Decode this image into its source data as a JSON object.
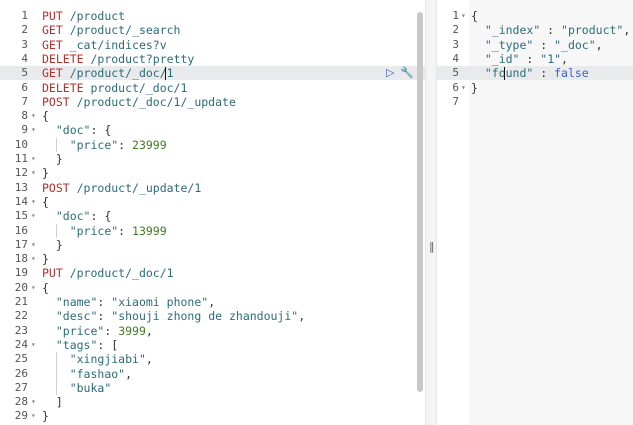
{
  "request_editor": {
    "lines": [
      {
        "n": "1",
        "fold": false,
        "tokens": [
          [
            "method",
            "PUT"
          ],
          [
            "path",
            " /product"
          ]
        ]
      },
      {
        "n": "2",
        "fold": false,
        "tokens": [
          [
            "method",
            "GET"
          ],
          [
            "path",
            " /product/_search"
          ]
        ]
      },
      {
        "n": "3",
        "fold": false,
        "tokens": [
          [
            "method",
            "GET"
          ],
          [
            "path",
            " _cat/indices?v"
          ]
        ]
      },
      {
        "n": "4",
        "fold": false,
        "tokens": [
          [
            "method",
            "DELETE"
          ],
          [
            "path",
            " /product?pretty"
          ]
        ]
      },
      {
        "n": "5",
        "fold": false,
        "tokens": [
          [
            "method",
            "GET"
          ],
          [
            "path",
            " /product/_doc/1"
          ]
        ]
      },
      {
        "n": "6",
        "fold": false,
        "tokens": [
          [
            "method",
            "DELETE"
          ],
          [
            "path",
            " product/_doc/1"
          ]
        ]
      },
      {
        "n": "7",
        "fold": false,
        "tokens": [
          [
            "method",
            "POST"
          ],
          [
            "path",
            " /product/_doc/1/_update"
          ]
        ]
      },
      {
        "n": "8",
        "fold": true,
        "tokens": [
          [
            "brace",
            "{"
          ]
        ]
      },
      {
        "n": "9",
        "fold": true,
        "tokens": [
          [
            "brace",
            "  "
          ],
          [
            "key",
            "\"doc\""
          ],
          [
            "brace",
            ": {"
          ]
        ]
      },
      {
        "n": "10",
        "fold": false,
        "tokens": [
          [
            "brace",
            "    "
          ],
          [
            "key",
            "\"price\""
          ],
          [
            "brace",
            ": "
          ],
          [
            "num",
            "23999"
          ]
        ]
      },
      {
        "n": "11",
        "fold": true,
        "tokens": [
          [
            "brace",
            "  }"
          ]
        ]
      },
      {
        "n": "12",
        "fold": true,
        "tokens": [
          [
            "brace",
            "}"
          ]
        ]
      },
      {
        "n": "13",
        "fold": false,
        "tokens": [
          [
            "method",
            "POST"
          ],
          [
            "path",
            " /product/_update/1"
          ]
        ]
      },
      {
        "n": "14",
        "fold": true,
        "tokens": [
          [
            "brace",
            "{"
          ]
        ]
      },
      {
        "n": "15",
        "fold": true,
        "tokens": [
          [
            "brace",
            "  "
          ],
          [
            "key",
            "\"doc\""
          ],
          [
            "brace",
            ": {"
          ]
        ]
      },
      {
        "n": "16",
        "fold": false,
        "tokens": [
          [
            "brace",
            "    "
          ],
          [
            "key",
            "\"price\""
          ],
          [
            "brace",
            ": "
          ],
          [
            "num",
            "13999"
          ]
        ]
      },
      {
        "n": "17",
        "fold": true,
        "tokens": [
          [
            "brace",
            "  }"
          ]
        ]
      },
      {
        "n": "18",
        "fold": true,
        "tokens": [
          [
            "brace",
            "}"
          ]
        ]
      },
      {
        "n": "19",
        "fold": false,
        "tokens": [
          [
            "method",
            "PUT"
          ],
          [
            "path",
            " /product/_doc/1"
          ]
        ]
      },
      {
        "n": "20",
        "fold": true,
        "tokens": [
          [
            "brace",
            "{"
          ]
        ]
      },
      {
        "n": "21",
        "fold": false,
        "tokens": [
          [
            "brace",
            "  "
          ],
          [
            "key",
            "\"name\""
          ],
          [
            "brace",
            ": "
          ],
          [
            "str",
            "\"xiaomi phone\""
          ],
          [
            "brace",
            ","
          ]
        ]
      },
      {
        "n": "22",
        "fold": false,
        "tokens": [
          [
            "brace",
            "  "
          ],
          [
            "key",
            "\"desc\""
          ],
          [
            "brace",
            ": "
          ],
          [
            "str",
            "\"shouji zhong de zhandouji\""
          ],
          [
            "brace",
            ","
          ]
        ]
      },
      {
        "n": "23",
        "fold": false,
        "tokens": [
          [
            "brace",
            "  "
          ],
          [
            "key",
            "\"price\""
          ],
          [
            "brace",
            ": "
          ],
          [
            "num",
            "3999"
          ],
          [
            "brace",
            ","
          ]
        ]
      },
      {
        "n": "24",
        "fold": true,
        "tokens": [
          [
            "brace",
            "  "
          ],
          [
            "key",
            "\"tags\""
          ],
          [
            "brace",
            ": ["
          ]
        ]
      },
      {
        "n": "25",
        "fold": false,
        "tokens": [
          [
            "brace",
            "    "
          ],
          [
            "str",
            "\"xingjiabi\""
          ],
          [
            "brace",
            ","
          ]
        ]
      },
      {
        "n": "26",
        "fold": false,
        "tokens": [
          [
            "brace",
            "    "
          ],
          [
            "str",
            "\"fashao\""
          ],
          [
            "brace",
            ","
          ]
        ]
      },
      {
        "n": "27",
        "fold": false,
        "tokens": [
          [
            "brace",
            "    "
          ],
          [
            "str",
            "\"buka\""
          ]
        ]
      },
      {
        "n": "28",
        "fold": true,
        "tokens": [
          [
            "brace",
            "  ]"
          ]
        ]
      },
      {
        "n": "29",
        "fold": true,
        "tokens": [
          [
            "brace",
            "}"
          ]
        ]
      }
    ],
    "active_line": "5",
    "action_icons": [
      "play-icon",
      "wrench-icon"
    ]
  },
  "response_viewer": {
    "lines": [
      {
        "n": "1",
        "fold": true,
        "tokens": [
          [
            "brace",
            "{"
          ]
        ]
      },
      {
        "n": "2",
        "fold": false,
        "tokens": [
          [
            "brace",
            "  "
          ],
          [
            "key",
            "\"_index\""
          ],
          [
            "brace",
            " : "
          ],
          [
            "str",
            "\"product\""
          ],
          [
            "brace",
            ","
          ]
        ]
      },
      {
        "n": "3",
        "fold": false,
        "tokens": [
          [
            "brace",
            "  "
          ],
          [
            "key",
            "\"_type\""
          ],
          [
            "brace",
            " : "
          ],
          [
            "str",
            "\"_doc\""
          ],
          [
            "brace",
            ","
          ]
        ]
      },
      {
        "n": "4",
        "fold": false,
        "tokens": [
          [
            "brace",
            "  "
          ],
          [
            "key",
            "\"_id\""
          ],
          [
            "brace",
            " : "
          ],
          [
            "str",
            "\"1\""
          ],
          [
            "brace",
            ","
          ]
        ]
      },
      {
        "n": "5",
        "fold": false,
        "tokens": [
          [
            "brace",
            "  "
          ],
          [
            "key",
            "\"found\""
          ],
          [
            "brace",
            " : "
          ],
          [
            "bool",
            "false"
          ]
        ]
      },
      {
        "n": "6",
        "fold": true,
        "tokens": [
          [
            "brace",
            "}"
          ]
        ]
      },
      {
        "n": "7",
        "fold": false,
        "tokens": []
      }
    ],
    "active_line": "5"
  },
  "colors": {
    "method": "#b4312b",
    "path": "#2c6b7a",
    "number": "#3c7d1e",
    "boolean": "#3b62c4",
    "active_line": "#e8eaec"
  }
}
